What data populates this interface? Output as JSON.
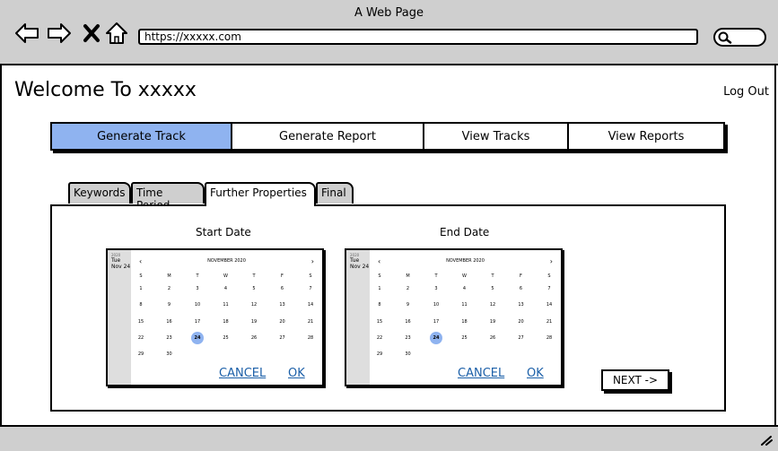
{
  "window": {
    "title": "A Web Page"
  },
  "browser": {
    "url": "https://xxxxx.com"
  },
  "header": {
    "welcome": "Welcome To xxxxx",
    "logout": "Log Out"
  },
  "nav": {
    "items": [
      {
        "label": "Generate Track",
        "active": true
      },
      {
        "label": "Generate Report",
        "active": false
      },
      {
        "label": "View Tracks",
        "active": false
      },
      {
        "label": "View Reports",
        "active": false
      }
    ]
  },
  "tabs": [
    {
      "label": "Keywords",
      "active": false
    },
    {
      "label": "Time Period",
      "active": false
    },
    {
      "label": "Further Properties",
      "active": true
    },
    {
      "label": "Final",
      "active": false
    }
  ],
  "start_calendar": {
    "title": "Start Date",
    "side_year": "2020",
    "side_dow": "Tue",
    "side_date": "Nov 24",
    "month": "NOVEMBER 2020",
    "weekdays": [
      "S",
      "M",
      "T",
      "W",
      "T",
      "F",
      "S"
    ],
    "weeks": [
      [
        "1",
        "2",
        "3",
        "4",
        "5",
        "6",
        "7"
      ],
      [
        "8",
        "9",
        "10",
        "11",
        "12",
        "13",
        "14"
      ],
      [
        "15",
        "16",
        "17",
        "18",
        "19",
        "20",
        "21"
      ],
      [
        "22",
        "23",
        "24",
        "25",
        "26",
        "27",
        "28"
      ],
      [
        "29",
        "30",
        "",
        "",
        "",
        "",
        ""
      ]
    ],
    "selected": "24",
    "cancel": "CANCEL",
    "ok": "OK"
  },
  "end_calendar": {
    "title": "End Date",
    "side_year": "2020",
    "side_dow": "Tue",
    "side_date": "Nov 24",
    "month": "NOVEMBER 2020",
    "weekdays": [
      "S",
      "M",
      "T",
      "W",
      "T",
      "F",
      "S"
    ],
    "weeks": [
      [
        "1",
        "2",
        "3",
        "4",
        "5",
        "6",
        "7"
      ],
      [
        "8",
        "9",
        "10",
        "11",
        "12",
        "13",
        "14"
      ],
      [
        "15",
        "16",
        "17",
        "18",
        "19",
        "20",
        "21"
      ],
      [
        "22",
        "23",
        "24",
        "25",
        "26",
        "27",
        "28"
      ],
      [
        "29",
        "30",
        "",
        "",
        "",
        "",
        ""
      ]
    ],
    "selected": "24",
    "cancel": "CANCEL",
    "ok": "OK"
  },
  "next_button": "NEXT ->",
  "colors": {
    "accent": "#8fb3f0",
    "chrome": "#cfcfcf",
    "link": "#1b5fa8"
  },
  "icons": [
    "back-arrow-icon",
    "forward-arrow-icon",
    "close-icon",
    "home-icon",
    "search-icon",
    "resize-grip-icon"
  ]
}
